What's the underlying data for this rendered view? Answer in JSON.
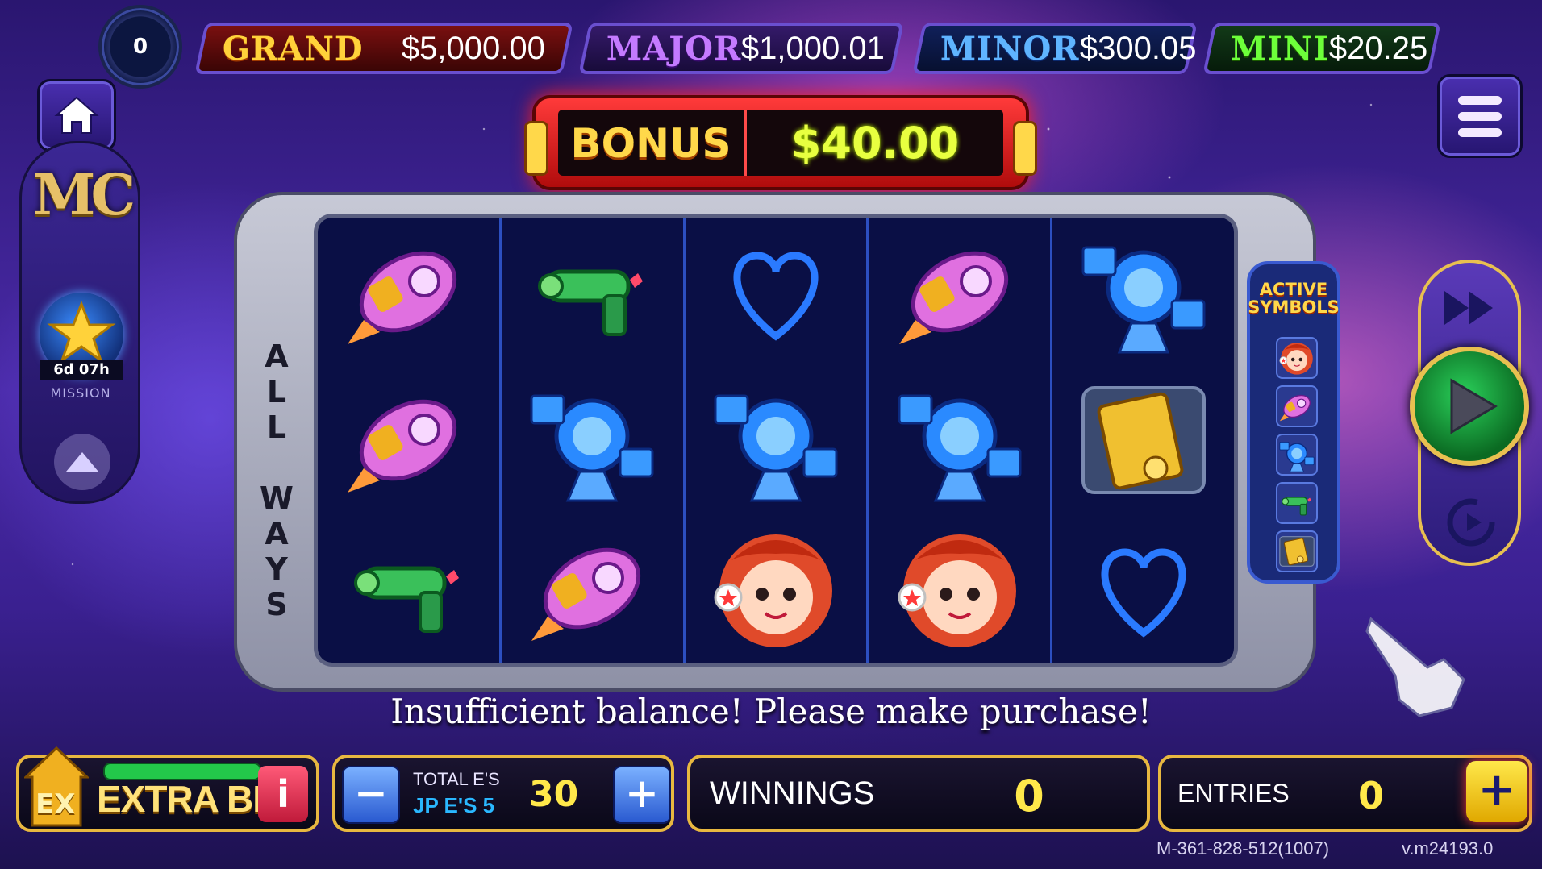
{
  "level": {
    "value": "0"
  },
  "jackpots": [
    {
      "name": "GRAND",
      "amount": "$5,000.00"
    },
    {
      "name": "MAJOR",
      "amount": "$1,000.01"
    },
    {
      "name": "MINOR",
      "amount": "$300.05"
    },
    {
      "name": "MINI",
      "amount": "$20.25"
    }
  ],
  "bonus": {
    "label": "BONUS",
    "amount": "$40.00"
  },
  "mission": {
    "logo": "MC",
    "timer": "6d 07h",
    "label": "MISSION"
  },
  "reels": {
    "side_label": "ALL WAYS",
    "columns": [
      [
        "rocket",
        "rocket",
        "ray-gun"
      ],
      [
        "ray-gun",
        "satellite",
        "rocket"
      ],
      [
        "heart",
        "satellite",
        "astronaut-girl"
      ],
      [
        "rocket",
        "satellite",
        "astronaut-girl"
      ],
      [
        "satellite",
        "gold-card",
        "heart"
      ]
    ]
  },
  "active_symbols": {
    "title": "ACTIVE SYMBOLS",
    "icons": [
      "astronaut-girl",
      "rocket",
      "satellite",
      "ray-gun",
      "gold-card"
    ]
  },
  "message": "Insufficient balance! Please make purchase!",
  "extra_bet": {
    "badge": "EX",
    "label": "EXTRA BET",
    "info": "i"
  },
  "bet": {
    "minus": "−",
    "line1": "TOTAL E'S",
    "line2": "JP E'S 5",
    "value": "30",
    "plus": "+"
  },
  "winnings": {
    "label": "WINNINGS",
    "value": "0"
  },
  "entries": {
    "label": "ENTRIES",
    "value": "0",
    "add": "+"
  },
  "footer": {
    "machine_id": "M-361-828-512(1007)",
    "version": "v.m24193.0"
  },
  "colors": {
    "accent_gold": "#e8b840",
    "bonus_red": "#ff3a3a",
    "value_yellow": "#ffe84a"
  }
}
